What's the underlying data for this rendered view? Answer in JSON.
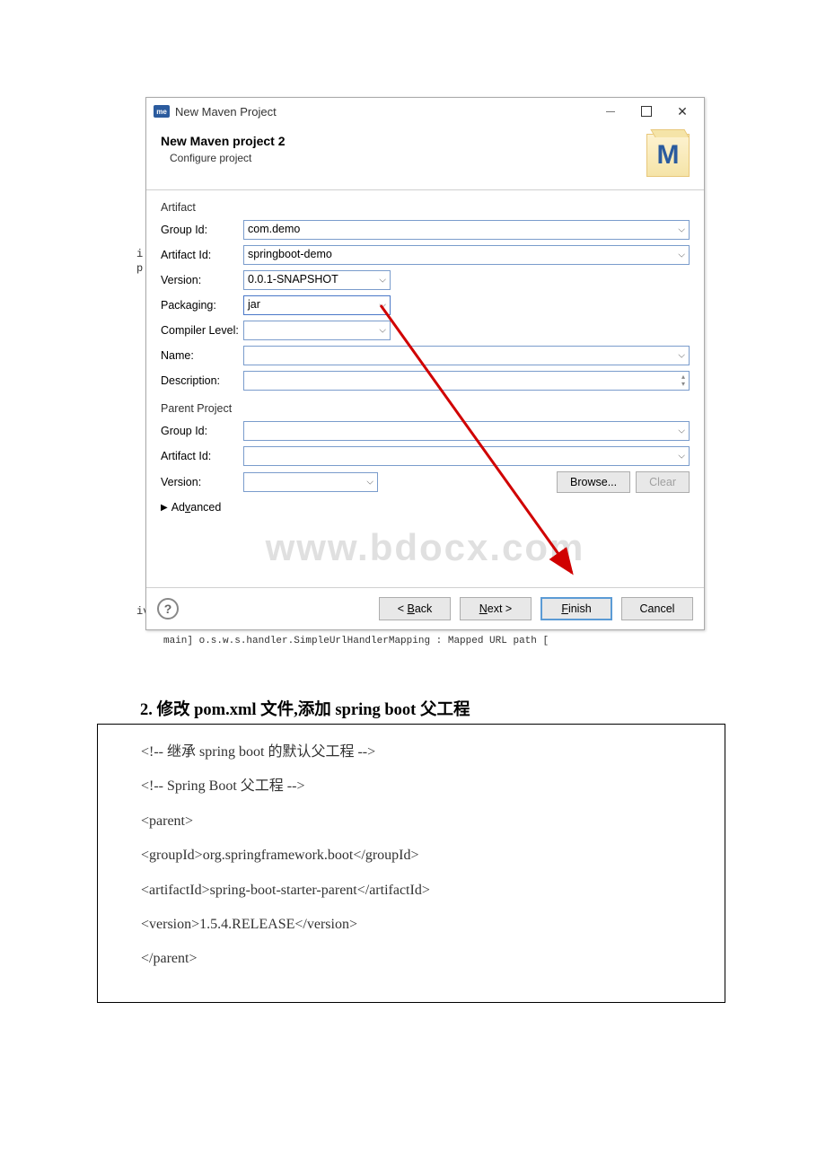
{
  "dialog": {
    "windowTitle": "New Maven Project",
    "bannerTitle": "New Maven project 2",
    "bannerSubtitle": "Configure project",
    "logoLetter": "M",
    "minimize": "—",
    "maximize": "□",
    "close": "✕"
  },
  "artifact": {
    "sectionLabel": "Artifact",
    "groupIdLabel": "Group Id:",
    "groupIdValue": "com.demo",
    "artifactIdLabel": "Artifact Id:",
    "artifactIdValue": "springboot-demo",
    "versionLabel": "Version:",
    "versionValue": "0.0.1-SNAPSHOT",
    "packagingLabel": "Packaging:",
    "packagingValue": "jar",
    "compilerLabel": "Compiler Level:",
    "compilerValue": "",
    "nameLabel": "Name:",
    "nameValue": "",
    "descLabel": "Description:",
    "descValue": ""
  },
  "parent": {
    "sectionLabel": "Parent Project",
    "groupIdLabel": "Group Id:",
    "groupIdValue": "",
    "artifactIdLabel": "Artifact Id:",
    "artifactIdValue": "",
    "versionLabel": "Version:",
    "versionValue": "",
    "browse": "Browse...",
    "clear": "Clear"
  },
  "advancedLabel": "Advanced",
  "watermark": "www.bdocx.com",
  "wizard": {
    "back": "< Back",
    "next": "Next >",
    "finish": "Finish",
    "cancel": "Cancel",
    "help": "?"
  },
  "fragments": {
    "left1": "i",
    "left2": "p",
    "left3": "iv",
    "bottom": "main] o.s.w.s.handler.SimpleUrlHandlerMapping   : Mapped URL path ["
  },
  "section2": {
    "heading": "2. 修改 pom.xml 文件,添加 spring boot 父工程",
    "line1": "<!-- 继承 spring boot 的默认父工程 -->",
    "line2": "<!-- Spring Boot 父工程 -->",
    "line3": "<parent>",
    "line4": "<groupId>org.springframework.boot</groupId>",
    "line5": "<artifactId>spring-boot-starter-parent</artifactId>",
    "line6": "<version>1.5.4.RELEASE</version>",
    "line7": "</parent>"
  }
}
